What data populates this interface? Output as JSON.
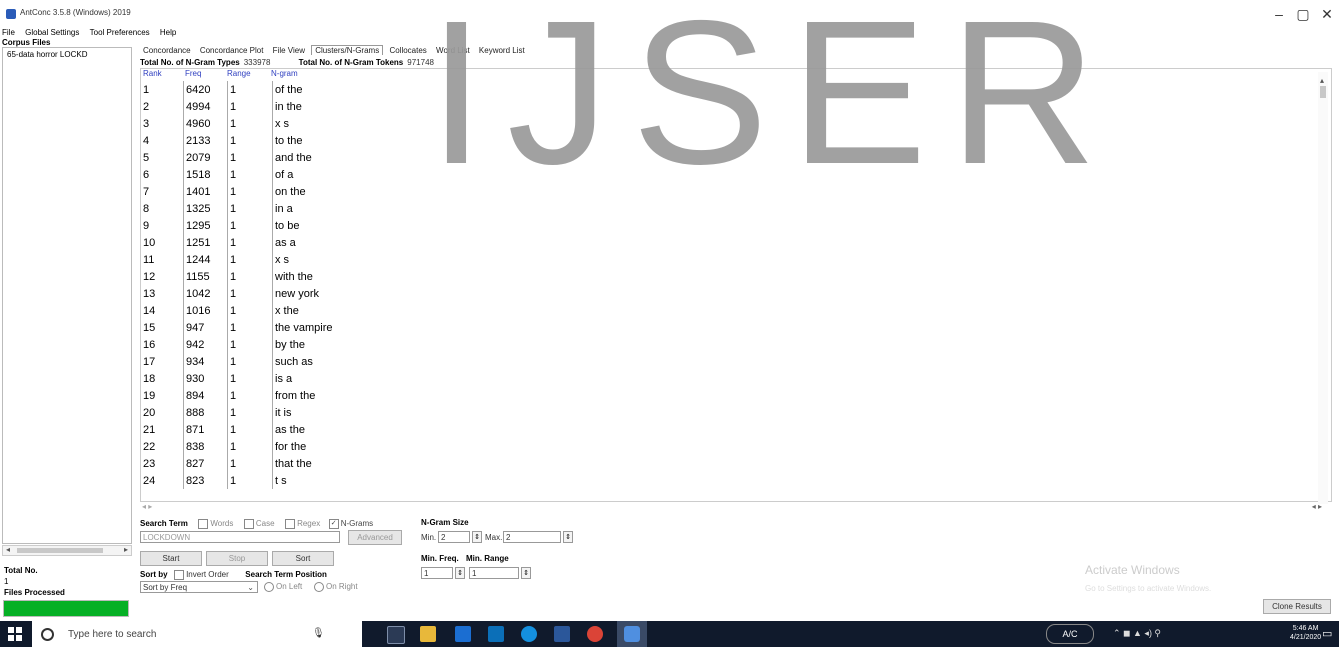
{
  "window": {
    "title": "AntConc 3.5.8 (Windows) 2019",
    "controls": [
      "–",
      "▢",
      "✕"
    ]
  },
  "menu": [
    "File",
    "Global Settings",
    "Tool Preferences",
    "Help"
  ],
  "left_panel": {
    "header": "Corpus Files",
    "files": [
      "65-data horror LOCKD"
    ],
    "total_no_label": "Total No.",
    "total_no_value": "1",
    "files_processed_label": "Files Processed",
    "files_processed_progress": 1.0
  },
  "tabs": [
    "Concordance",
    "Concordance Plot",
    "File View",
    "Clusters/N-Grams",
    "Collocates",
    "Word List",
    "Keyword List"
  ],
  "active_tab": "Clusters/N-Grams",
  "summary": {
    "types_label": "Total No. of N-Gram Types",
    "types_value": "333978",
    "tokens_label": "Total No. of N-Gram Tokens",
    "tokens_value": "971748"
  },
  "columns": [
    "Rank",
    "Freq",
    "Range",
    "N-gram"
  ],
  "rows": [
    [
      "1",
      "6420",
      "1",
      "of the"
    ],
    [
      "2",
      "4994",
      "1",
      "in the"
    ],
    [
      "3",
      "4960",
      "1",
      "x s"
    ],
    [
      "4",
      "2133",
      "1",
      "to the"
    ],
    [
      "5",
      "2079",
      "1",
      "and the"
    ],
    [
      "6",
      "1518",
      "1",
      "of a"
    ],
    [
      "7",
      "1401",
      "1",
      "on the"
    ],
    [
      "8",
      "1325",
      "1",
      "in a"
    ],
    [
      "9",
      "1295",
      "1",
      "to be"
    ],
    [
      "10",
      "1251",
      "1",
      "as a"
    ],
    [
      "11",
      "1244",
      "1",
      "x s"
    ],
    [
      "12",
      "1155",
      "1",
      "with the"
    ],
    [
      "13",
      "1042",
      "1",
      "new york"
    ],
    [
      "14",
      "1016",
      "1",
      "x the"
    ],
    [
      "15",
      "947",
      "1",
      "the vampire"
    ],
    [
      "16",
      "942",
      "1",
      "by the"
    ],
    [
      "17",
      "934",
      "1",
      "such as"
    ],
    [
      "18",
      "930",
      "1",
      "is a"
    ],
    [
      "19",
      "894",
      "1",
      "from the"
    ],
    [
      "20",
      "888",
      "1",
      "it is"
    ],
    [
      "21",
      "871",
      "1",
      "as the"
    ],
    [
      "22",
      "838",
      "1",
      "for the"
    ],
    [
      "23",
      "827",
      "1",
      "that the"
    ],
    [
      "24",
      "823",
      "1",
      "t s"
    ]
  ],
  "controls": {
    "search_term_label": "Search Term",
    "words_label": "Words",
    "case_label": "Case",
    "regex_label": "Regex",
    "ngrams_label": "N-Grams",
    "ngrams_checked": true,
    "search_value": "LOCKDOWN",
    "advanced_label": "Advanced",
    "start_label": "Start",
    "stop_label": "Stop",
    "sort_label": "Sort",
    "sort_by_label": "Sort by",
    "invert_order_label": "Invert Order",
    "sort_by_value": "Sort by Freq",
    "search_term_position_label": "Search Term Position",
    "on_left_label": "On Left",
    "on_right_label": "On Right",
    "ngram_size_label": "N-Gram Size",
    "min_label": "Min.",
    "min_value": "2",
    "max_label": "Max.",
    "max_value": "2",
    "min_freq_label": "Min. Freq.",
    "min_range_label": "Min. Range",
    "min_freq_value": "1",
    "min_range_value": "1",
    "clone_results_label": "Clone Results"
  },
  "watermark": "IJSER",
  "activate_windows": {
    "title": "Activate Windows",
    "subtitle": "Go to Settings to activate Windows."
  },
  "taskbar": {
    "search_placeholder": "Type here to search",
    "ac_label": "A/C",
    "time": "5:46 AM",
    "date": "4/21/2020"
  }
}
